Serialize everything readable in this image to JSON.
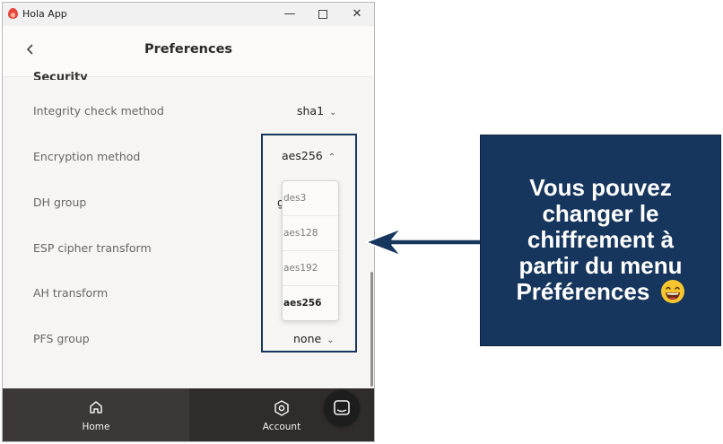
{
  "window": {
    "title": "Hola App",
    "controls": {
      "minimize": "—",
      "close": "✕"
    }
  },
  "header": {
    "back_icon": "chevron-left-icon",
    "title": "Preferences"
  },
  "section": {
    "title": "Security"
  },
  "rows": [
    {
      "label": "Integrity check method",
      "value": "sha1",
      "chevron": "chevron-down-icon"
    },
    {
      "label": "Encryption method",
      "value": "aes256",
      "chevron": "chevron-up-icon"
    },
    {
      "label": "DH group",
      "value": "g"
    },
    {
      "label": "ESP cipher transform",
      "value": ""
    },
    {
      "label": "AH transform",
      "value": ""
    },
    {
      "label": "PFS group",
      "value": "none",
      "chevron": "chevron-down-icon"
    }
  ],
  "dropdown": {
    "options": [
      "des3",
      "aes128",
      "aes192",
      "aes256"
    ],
    "selected": "aes256"
  },
  "bottom_nav": {
    "items": [
      {
        "label": "Home",
        "icon": "home-icon",
        "active": true
      },
      {
        "label": "Account",
        "icon": "settings-icon",
        "active": false
      }
    ],
    "chat_icon": "chat-icon"
  },
  "callout": {
    "lines": [
      "Vous pouvez",
      "changer le",
      "chiffrement à",
      "partir du menu",
      "Préférences"
    ],
    "emoji": "grinning-face-emoji"
  },
  "colors": {
    "annotation_navy": "#17365d",
    "nav_background": "#2f2c2b",
    "content_background": "#f7f5f3"
  }
}
